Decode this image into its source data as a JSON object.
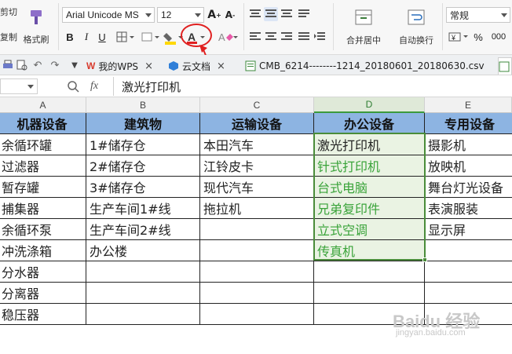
{
  "ribbon": {
    "cut_label": "剪切",
    "copy_label": "复制",
    "format_painter_label": "格式刷",
    "font_name": "Arial Unicode MS",
    "font_size": "12",
    "merge_center_label": "合并居中",
    "wrap_text_label": "自动换行",
    "number_format": "常规"
  },
  "tabs": [
    {
      "label": "我的WPS"
    },
    {
      "label": "云文档"
    },
    {
      "label": "CMB_6214--------1214_20180601_20180630.csv"
    }
  ],
  "formula_bar": {
    "cell_ref": "",
    "fx_label": "fx",
    "content": "激光打印机"
  },
  "grid": {
    "col_headers": [
      "A",
      "B",
      "C",
      "D",
      "E"
    ],
    "header_row": [
      "机器设备",
      "建筑物",
      "运输设备",
      "办公设备",
      "专用设备"
    ],
    "rows": [
      [
        "余循环罐",
        "1#储存仓",
        "本田汽车",
        "激光打印机",
        "摄影机"
      ],
      [
        "过滤器",
        "2#储存仓",
        "江铃皮卡",
        "针式打印机",
        "放映机"
      ],
      [
        "暂存罐",
        "3#储存仓",
        "现代汽车",
        "台式电脑",
        "舞台灯光设备"
      ],
      [
        "捕集器",
        "生产车间1#线",
        "拖拉机",
        "兄弟复印件",
        "表演服装"
      ],
      [
        "余循环泵",
        "生产车间2#线",
        "",
        "立式空调",
        "显示屏"
      ],
      [
        "冲洗涤箱",
        "办公楼",
        "",
        "传真机",
        ""
      ],
      [
        "分水器",
        "",
        "",
        "",
        ""
      ],
      [
        "分离器",
        "",
        "",
        "",
        ""
      ],
      [
        "稳压器",
        "",
        "",
        "",
        ""
      ]
    ]
  },
  "watermark": {
    "main": "Baidu 经验",
    "sub": "jingyan.baidu.com"
  },
  "colors": {
    "accent_green": "#39a339",
    "header_fill": "#8db4e2",
    "callout_red": "#e02020"
  }
}
